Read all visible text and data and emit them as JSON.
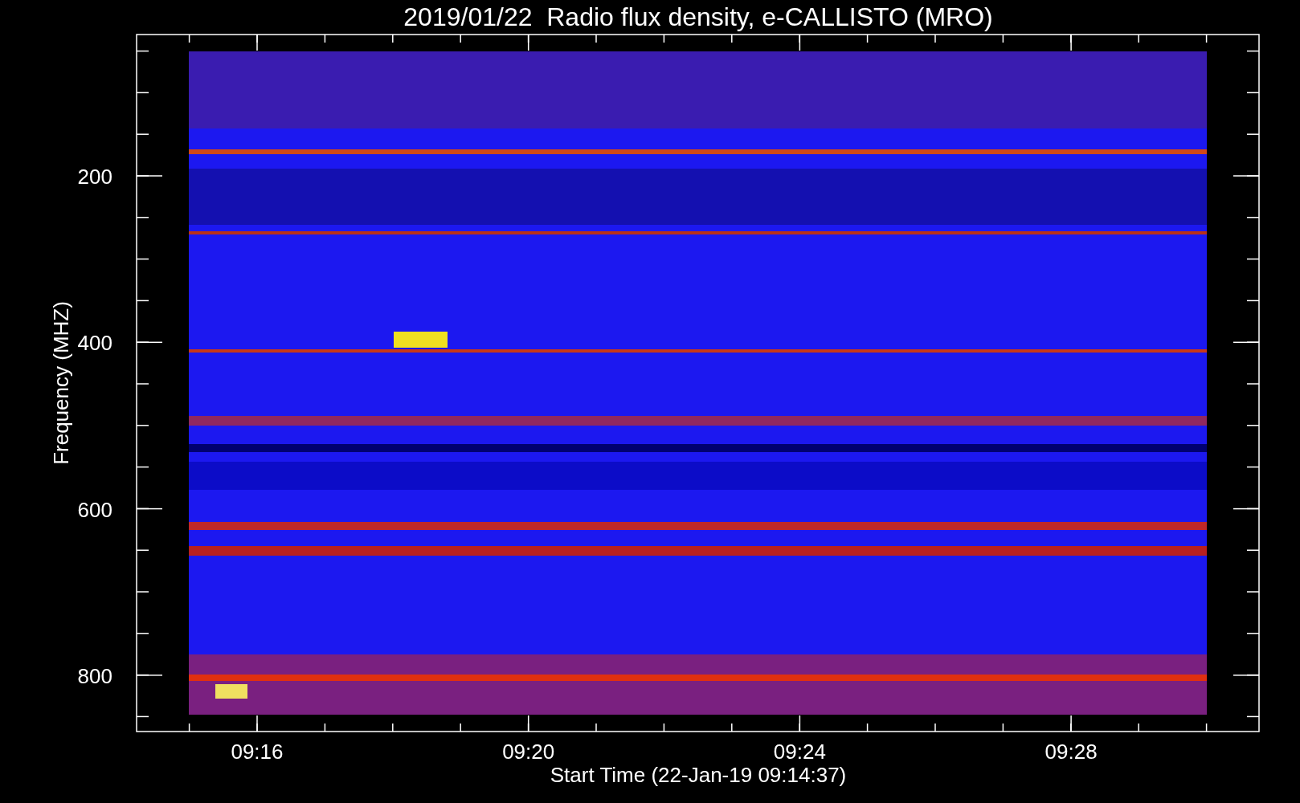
{
  "title": "2019/01/22  Radio flux density, e-CALLISTO (MRO)",
  "y_axis": {
    "label": "Frequency (MHZ)",
    "ticks": [
      "200",
      "400",
      "600",
      "800"
    ]
  },
  "x_axis": {
    "label": "Start Time (22-Jan-19 09:14:37)",
    "ticks": [
      "09:16",
      "09:20",
      "09:24",
      "09:28"
    ]
  }
}
